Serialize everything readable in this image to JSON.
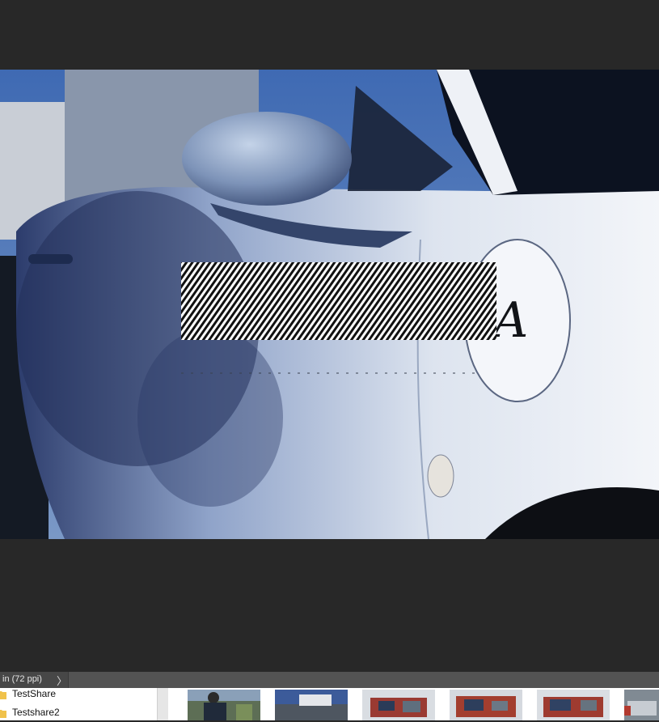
{
  "status_bar": {
    "zoom_text": "in (72 ppi)",
    "chevron": "〉"
  },
  "folders": [
    {
      "label": "TestShare",
      "icon": "folder-icon"
    },
    {
      "label": "Testshare2",
      "icon": "folder-icon"
    }
  ],
  "thumbnails": [
    {
      "icon": "photo-thumbnail"
    },
    {
      "icon": "photo-thumbnail"
    },
    {
      "icon": "photo-thumbnail"
    },
    {
      "icon": "photo-thumbnail"
    },
    {
      "icon": "photo-thumbnail"
    },
    {
      "icon": "photo-thumbnail"
    }
  ],
  "colors": {
    "background": "#282828",
    "status_bar": "#535353",
    "folder_icon": "#f0c24b"
  }
}
